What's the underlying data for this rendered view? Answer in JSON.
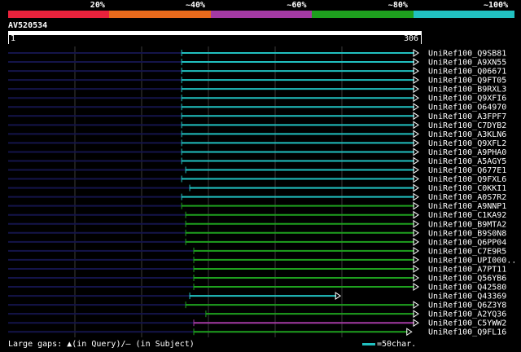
{
  "query": {
    "id": "AV520534",
    "start_label": "1",
    "end_label": "306",
    "length": 306
  },
  "legend": [
    {
      "label": "20%",
      "color": "#e8223c"
    },
    {
      "label": "~40%",
      "color": "#e86a1c"
    },
    {
      "label": "~60%",
      "color": "#a43aa4"
    },
    {
      "label": "~80%",
      "color": "#1ea01e"
    },
    {
      "label": "~100%",
      "color": "#21c0c0"
    }
  ],
  "colors": {
    "cyan": "#21c0c0",
    "green": "#1ea01e",
    "purple": "#a43aa4",
    "navy": "#14144a"
  },
  "footer": {
    "gaps_label": "Large gaps: ▲(in Query)/– (in Subject)",
    "scale_label": "=50char."
  },
  "chart_data": {
    "type": "alignment",
    "x_range": [
      1,
      306
    ],
    "hits": [
      {
        "name": "UniRef100_Q9SB81",
        "qstart": 130,
        "qend": 306,
        "color": "#21c0c0"
      },
      {
        "name": "UniRef100_A9XN55",
        "qstart": 130,
        "qend": 306,
        "color": "#21c0c0"
      },
      {
        "name": "UniRef100_Q06671",
        "qstart": 130,
        "qend": 306,
        "color": "#21c0c0"
      },
      {
        "name": "UniRef100_Q9FT05",
        "qstart": 130,
        "qend": 306,
        "color": "#21c0c0"
      },
      {
        "name": "UniRef100_B9RXL3",
        "qstart": 130,
        "qend": 306,
        "color": "#21c0c0"
      },
      {
        "name": "UniRef100_Q9XFI6",
        "qstart": 130,
        "qend": 306,
        "color": "#21c0c0"
      },
      {
        "name": "UniRef100_O64970",
        "qstart": 130,
        "qend": 306,
        "color": "#21c0c0"
      },
      {
        "name": "UniRef100_A3FPF7",
        "qstart": 130,
        "qend": 306,
        "color": "#21c0c0"
      },
      {
        "name": "UniRef100_C7DYB2",
        "qstart": 130,
        "qend": 306,
        "color": "#21c0c0"
      },
      {
        "name": "UniRef100_A3KLN6",
        "qstart": 130,
        "qend": 306,
        "color": "#21c0c0"
      },
      {
        "name": "UniRef100_Q9XFL2",
        "qstart": 130,
        "qend": 306,
        "color": "#21c0c0"
      },
      {
        "name": "UniRef100_A9PHA0",
        "qstart": 130,
        "qend": 306,
        "color": "#21c0c0"
      },
      {
        "name": "UniRef100_A5AGY5",
        "qstart": 130,
        "qend": 306,
        "color": "#21c0c0"
      },
      {
        "name": "UniRef100_Q677E1",
        "qstart": 133,
        "qend": 306,
        "color": "#21c0c0"
      },
      {
        "name": "UniRef100_Q9FXL6",
        "qstart": 130,
        "qend": 306,
        "color": "#21c0c0"
      },
      {
        "name": "UniRef100_C0KKI1",
        "qstart": 136,
        "qend": 306,
        "color": "#21c0c0"
      },
      {
        "name": "UniRef100_A0S7R2",
        "qstart": 130,
        "qend": 306,
        "color": "#21c0c0"
      },
      {
        "name": "UniRef100_A9NNP1",
        "qstart": 130,
        "qend": 306,
        "color": "#1ea01e"
      },
      {
        "name": "UniRef100_C1KA92",
        "qstart": 133,
        "qend": 306,
        "color": "#1ea01e"
      },
      {
        "name": "UniRef100_B9MTA2",
        "qstart": 133,
        "qend": 306,
        "color": "#1ea01e"
      },
      {
        "name": "UniRef100_B9S0N8",
        "qstart": 133,
        "qend": 306,
        "color": "#1ea01e"
      },
      {
        "name": "UniRef100_Q6PP04",
        "qstart": 133,
        "qend": 306,
        "color": "#1ea01e"
      },
      {
        "name": "UniRef100_C7E9R5",
        "qstart": 139,
        "qend": 306,
        "color": "#1ea01e"
      },
      {
        "name": "UniRef100_UPI000..",
        "qstart": 139,
        "qend": 306,
        "color": "#1ea01e"
      },
      {
        "name": "UniRef100_A7PT11",
        "qstart": 139,
        "qend": 306,
        "color": "#1ea01e"
      },
      {
        "name": "UniRef100_Q56YB6",
        "qstart": 139,
        "qend": 306,
        "color": "#1ea01e"
      },
      {
        "name": "UniRef100_Q42580",
        "qstart": 139,
        "qend": 306,
        "color": "#1ea01e"
      },
      {
        "name": "UniRef100_Q43369",
        "qstart": 136,
        "qend": 248,
        "color": "#21c0c0"
      },
      {
        "name": "UniRef100_Q6Z3Y8",
        "qstart": 133,
        "qend": 306,
        "color": "#1ea01e"
      },
      {
        "name": "UniRef100_A2YQ36",
        "qstart": 148,
        "qend": 306,
        "color": "#1ea01e"
      },
      {
        "name": "UniRef100_C5YWW2",
        "qstart": 139,
        "qend": 306,
        "color": "#a43aa4"
      },
      {
        "name": "UniRef100_Q9FL16",
        "qstart": 139,
        "qend": 301,
        "color": "#1ea01e"
      }
    ]
  }
}
